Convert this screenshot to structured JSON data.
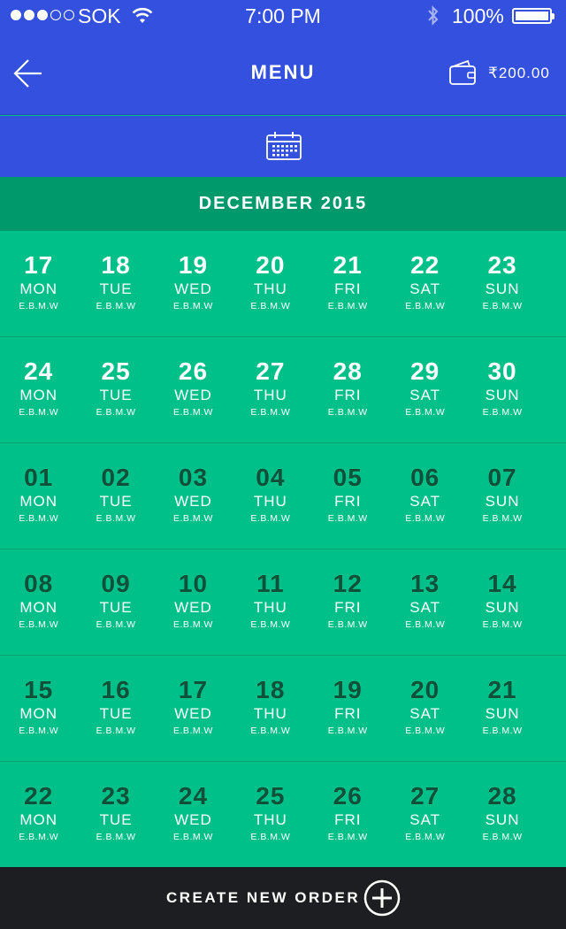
{
  "status_bar": {
    "carrier": "SOK",
    "time": "7:00 PM",
    "battery": "100%",
    "signal_dots_filled": 3,
    "signal_dots_total": 5
  },
  "header": {
    "title": "MENU",
    "balance": "₹200.00",
    "back_icon": "arrow-left-icon",
    "wallet_icon": "wallet-icon"
  },
  "calendar_bar": {
    "icon": "calendar-icon"
  },
  "month": "DECEMBER 2015",
  "weeks": [
    {
      "tone": "light",
      "days": [
        {
          "num": "17",
          "name": "MON",
          "meals": "E.B.M.W"
        },
        {
          "num": "18",
          "name": "TUE",
          "meals": "E.B.M.W"
        },
        {
          "num": "19",
          "name": "WED",
          "meals": "E.B.M.W"
        },
        {
          "num": "20",
          "name": "THU",
          "meals": "E.B.M.W"
        },
        {
          "num": "21",
          "name": "FRI",
          "meals": "E.B.M.W"
        },
        {
          "num": "22",
          "name": "SAT",
          "meals": "E.B.M.W"
        },
        {
          "num": "23",
          "name": "SUN",
          "meals": "E.B.M.W"
        }
      ]
    },
    {
      "tone": "light",
      "days": [
        {
          "num": "24",
          "name": "MON",
          "meals": "E.B.M.W"
        },
        {
          "num": "25",
          "name": "TUE",
          "meals": "E.B.M.W"
        },
        {
          "num": "26",
          "name": "WED",
          "meals": "E.B.M.W"
        },
        {
          "num": "27",
          "name": "THU",
          "meals": "E.B.M.W"
        },
        {
          "num": "28",
          "name": "FRI",
          "meals": "E.B.M.W"
        },
        {
          "num": "29",
          "name": "SAT",
          "meals": "E.B.M.W"
        },
        {
          "num": "30",
          "name": "SUN",
          "meals": "E.B.M.W"
        }
      ]
    },
    {
      "tone": "dark",
      "days": [
        {
          "num": "01",
          "name": "MON",
          "meals": "E.B.M.W"
        },
        {
          "num": "02",
          "name": "TUE",
          "meals": "E.B.M.W"
        },
        {
          "num": "03",
          "name": "WED",
          "meals": "E.B.M.W"
        },
        {
          "num": "04",
          "name": "THU",
          "meals": "E.B.M.W"
        },
        {
          "num": "05",
          "name": "FRI",
          "meals": "E.B.M.W"
        },
        {
          "num": "06",
          "name": "SAT",
          "meals": "E.B.M.W"
        },
        {
          "num": "07",
          "name": "SUN",
          "meals": "E.B.M.W"
        }
      ]
    },
    {
      "tone": "dark",
      "days": [
        {
          "num": "08",
          "name": "MON",
          "meals": "E.B.M.W"
        },
        {
          "num": "09",
          "name": "TUE",
          "meals": "E.B.M.W"
        },
        {
          "num": "10",
          "name": "WED",
          "meals": "E.B.M.W"
        },
        {
          "num": "11",
          "name": "THU",
          "meals": "E.B.M.W"
        },
        {
          "num": "12",
          "name": "FRI",
          "meals": "E.B.M.W"
        },
        {
          "num": "13",
          "name": "SAT",
          "meals": "E.B.M.W"
        },
        {
          "num": "14",
          "name": "SUN",
          "meals": "E.B.M.W"
        }
      ]
    },
    {
      "tone": "dark",
      "days": [
        {
          "num": "15",
          "name": "MON",
          "meals": "E.B.M.W"
        },
        {
          "num": "16",
          "name": "TUE",
          "meals": "E.B.M.W"
        },
        {
          "num": "17",
          "name": "WED",
          "meals": "E.B.M.W"
        },
        {
          "num": "18",
          "name": "THU",
          "meals": "E.B.M.W"
        },
        {
          "num": "19",
          "name": "FRI",
          "meals": "E.B.M.W"
        },
        {
          "num": "20",
          "name": "SAT",
          "meals": "E.B.M.W"
        },
        {
          "num": "21",
          "name": "SUN",
          "meals": "E.B.M.W"
        }
      ]
    },
    {
      "tone": "dark",
      "days": [
        {
          "num": "22",
          "name": "MON",
          "meals": "E.B.M.W"
        },
        {
          "num": "23",
          "name": "TUE",
          "meals": "E.B.M.W"
        },
        {
          "num": "24",
          "name": "WED",
          "meals": "E.B.M.W"
        },
        {
          "num": "25",
          "name": "THU",
          "meals": "E.B.M.W"
        },
        {
          "num": "26",
          "name": "FRI",
          "meals": "E.B.M.W"
        },
        {
          "num": "27",
          "name": "SAT",
          "meals": "E.B.M.W"
        },
        {
          "num": "28",
          "name": "SUN",
          "meals": "E.B.M.W"
        }
      ]
    }
  ],
  "footer": {
    "label": "CREATE NEW ORDER",
    "icon": "plus-circle-icon"
  },
  "colors": {
    "header_blue": "#3350df",
    "month_bar_green": "#00996c",
    "grid_green": "#00c089",
    "dark_number": "#10503a",
    "footer_dark": "#1c1e22"
  }
}
